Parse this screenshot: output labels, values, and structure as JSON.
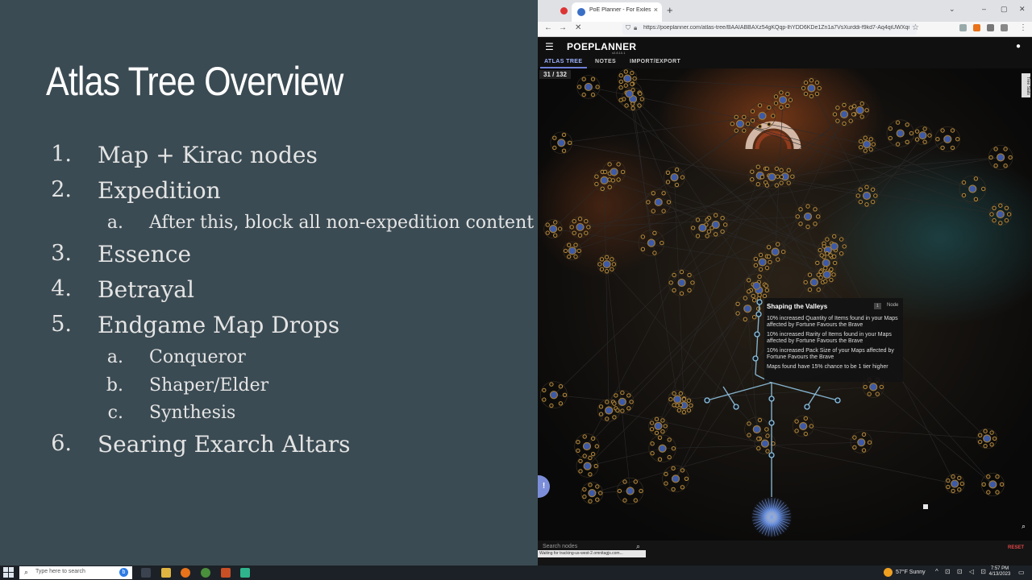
{
  "slide": {
    "title": "Atlas Tree Overview",
    "items": [
      {
        "num": "1.",
        "text": "Map + Kirac nodes"
      },
      {
        "num": "2.",
        "text": "Expedition"
      },
      {
        "num": "a.",
        "text": "After this, block all non-expedition content and"
      },
      {
        "num": "3.",
        "text": "Essence"
      },
      {
        "num": "4.",
        "text": "Betrayal"
      },
      {
        "num": "5.",
        "text": "Endgame Map Drops"
      },
      {
        "num": "a.",
        "text": "Conqueror"
      },
      {
        "num": "b.",
        "text": "Shaper/Elder"
      },
      {
        "num": "c.",
        "text": "Synthesis"
      },
      {
        "num": "6.",
        "text": "Searing Exarch Altars"
      }
    ]
  },
  "browser": {
    "tab_title": "PoE Planner - For Exiles, By Exiles",
    "tab_close": "×",
    "new_tab": "+",
    "window_controls": [
      "⌄",
      "–",
      "▢",
      "✕"
    ],
    "url": "https://poeplanner.com/atlas-tree/BAAIABBAXz54gKQqp-lhYDD6KDe1Zn1a7VsXurddi-f9kd7-Aq4qiUWXqr",
    "back": "←",
    "forward": "→",
    "reload": "✕",
    "star": "☆",
    "menu": "⋮"
  },
  "app": {
    "brand": "POEPLANNER",
    "version": "v2.8.10.1",
    "tabs": [
      "ATLAS TREE",
      "NOTES",
      "IMPORT/EXPORT"
    ],
    "active_tab": "ATLAS TREE",
    "points_allocated": "31 / 132",
    "side_tag": "Tree Stats",
    "tooltip": {
      "title": "Shaping the Valleys",
      "badge": "1",
      "badge_label": "Node",
      "stats": [
        "10% increased Quantity of Items found in your Maps affected by Fortune Favours the Brave",
        "10% increased Rarity of Items found in your Maps affected by Fortune Favours the Brave",
        "10% increased Pack Size of your Maps affected by Fortune Favours the Brave",
        "Maps found have 15% chance to be 1 tier higher"
      ]
    },
    "search_placeholder": "Search nodes",
    "reset_label": "RESET",
    "status_url": "Waiting for tracking-us-west-2.omnitagjs.com...",
    "fab_label": "!"
  },
  "taskbar": {
    "search_placeholder": "Type here to search",
    "bing_label": "b",
    "weather": "57°F  Sunny",
    "time": "7:57 PM",
    "date": "4/13/2023",
    "tray_icons": "^ ⊡ ⊡ ◁ ⊡"
  },
  "colors": {
    "slide_bg": "#3b4b53",
    "tree_bg": "#0b0b0d",
    "node_gold": "#b88a3a",
    "node_blue": "#3d5aa8",
    "path_allocated": "#8fc2e0",
    "accent": "#6e7fd6"
  }
}
